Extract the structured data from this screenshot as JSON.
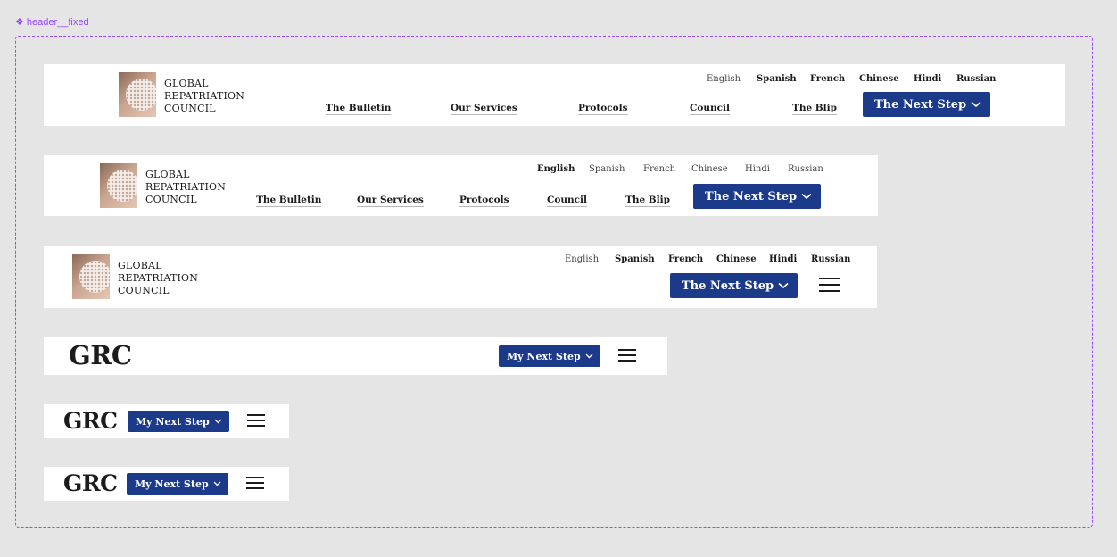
{
  "frame": {
    "label": "header__fixed"
  },
  "logo": {
    "lines": [
      "GLOBAL",
      "REPATRIATION",
      "COUNCIL"
    ],
    "short": "GRC"
  },
  "languages": [
    "English",
    "Spanish",
    "French",
    "Chinese",
    "Hindi",
    "Russian"
  ],
  "nav": [
    "The Bulletin",
    "Our Services",
    "Protocols",
    "Council",
    "The Blip"
  ],
  "cta": {
    "large": "The Next Step",
    "small": "My Next Step"
  },
  "colors": {
    "cta_bg": "#1b3a8a",
    "frame_border": "#9747ff",
    "canvas": "#e5e5e5"
  },
  "icons": {
    "menu": "hamburger-menu-icon",
    "dropdown": "chevron-down-icon",
    "frame": "component-icon"
  }
}
